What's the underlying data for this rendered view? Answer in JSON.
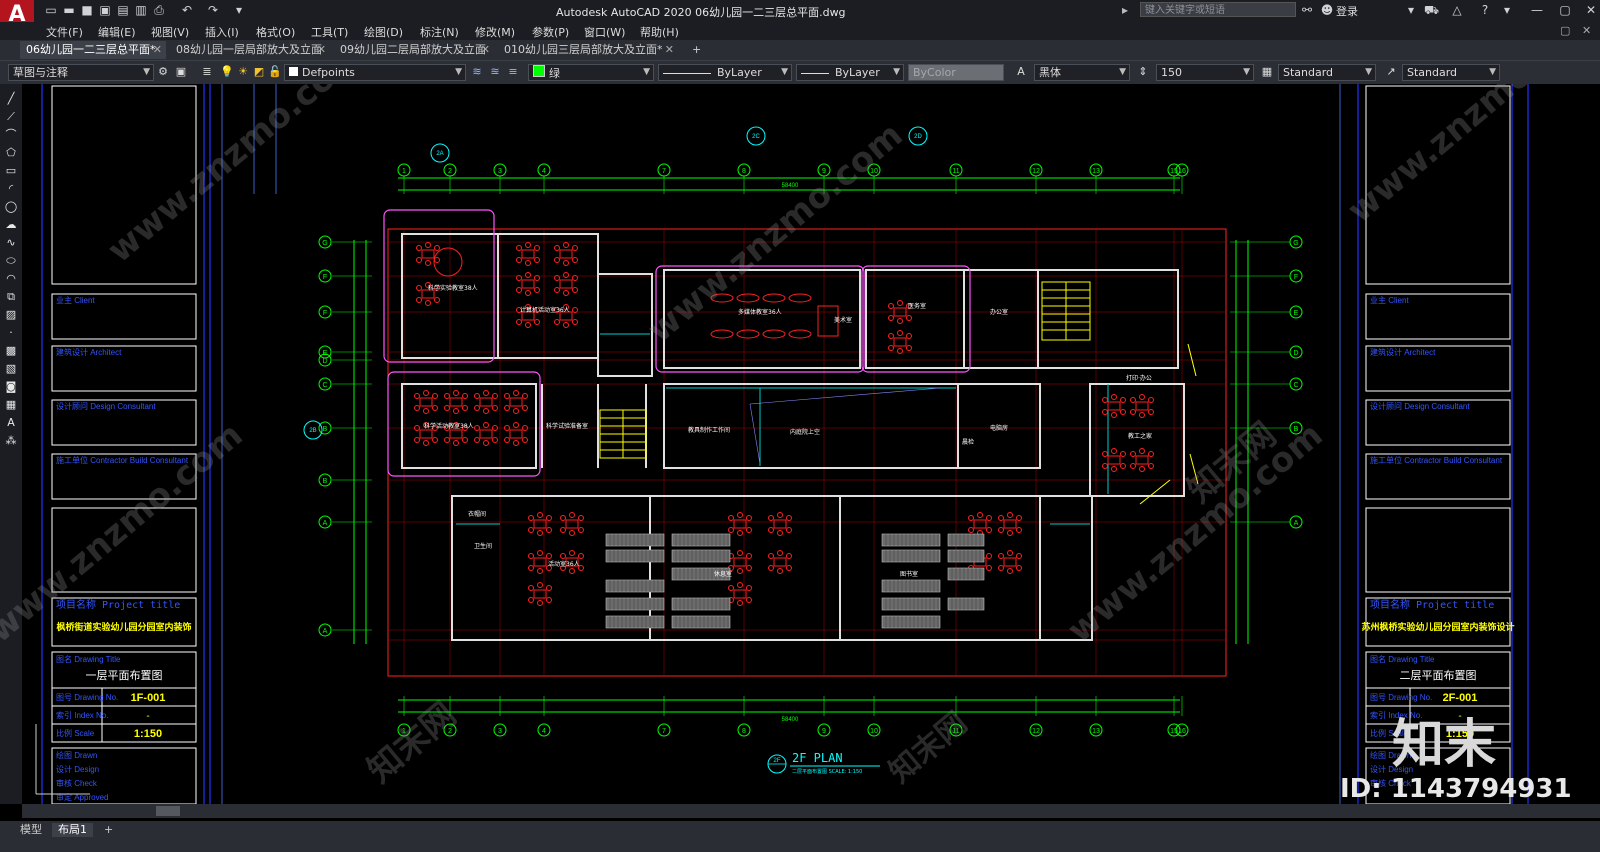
{
  "app": {
    "logo": "A",
    "title": "Autodesk AutoCAD 2020    06幼儿园一二三层总平面.dwg",
    "search_placeholder": "键入关键字或短语",
    "login": "登录"
  },
  "menu": [
    "文件(F)",
    "编辑(E)",
    "视图(V)",
    "插入(I)",
    "格式(O)",
    "工具(T)",
    "绘图(D)",
    "标注(N)",
    "修改(M)",
    "参数(P)",
    "窗口(W)",
    "帮助(H)"
  ],
  "tabs": [
    {
      "label": "06幼儿园一二三层总平面*",
      "active": true
    },
    {
      "label": "08幼儿园一层局部放大及立面",
      "active": false
    },
    {
      "label": "09幼儿园二层局部放大及立面",
      "active": false
    },
    {
      "label": "010幼儿园三层局部放大及立面*",
      "active": false
    }
  ],
  "toolbar": {
    "workspace": "草图与注释",
    "layer": "Defpoints",
    "color": "绿",
    "linetype": "ByLayer",
    "lineweight": "ByLayer",
    "plotstyle": "ByColor",
    "font": "黑体",
    "textheight": "150",
    "dimstyle": "Standard",
    "tablestyle": "Standard"
  },
  "left_titleblock": {
    "owner": "业主 Client",
    "architect": "建筑设计 Architect",
    "consultant": "设计顾问 Design Consultant",
    "contractor": "施工单位 Contractor Build Consultant",
    "project_title_label": "项目名称 Project title",
    "project_title": "枫桥街道实验幼儿园分园室内装饰",
    "drawing_title_label": "图名 Drawing Title",
    "drawing_title": "一层平面布置图",
    "drawing_no_label": "图号 Drawing No.",
    "drawing_no": "1F-001",
    "index_label": "索引 Index No.",
    "index": "-",
    "scale_label": "比例 Scale",
    "scale": "1:150",
    "drawn_label": "绘图 Drawn",
    "design_label": "设计 Design",
    "check_label": "审核 Check",
    "approved_label": "审定 Approved"
  },
  "right_titleblock": {
    "owner": "业主 Client",
    "architect": "建筑设计 Architect",
    "consultant": "设计顾问 Design Consultant",
    "contractor": "施工单位 Contractor Build Consultant",
    "project_title_label": "项目名称 Project title",
    "project_title": "苏州枫桥实验幼儿园分园室内装饰设计",
    "drawing_title_label": "图名 Drawing Title",
    "drawing_title": "二层平面布置图",
    "drawing_no_label": "图号 Drawing No.",
    "drawing_no": "2F-001",
    "index_label": "索引 Index No.",
    "index": "-",
    "scale_label": "比例 Scale",
    "scale": "1:150",
    "drawn_label": "绘图 Drawn",
    "design_label": "设计 Design",
    "check_label": "审核 Check"
  },
  "plan": {
    "title": "2F PLAN",
    "subtitle": "二层平面布置图    SCALE: 1:150",
    "title_tag": "2F",
    "axis_top": [
      "1",
      "2",
      "3",
      "4",
      "7",
      "8",
      "9",
      "10",
      "11",
      "12",
      "13",
      "15",
      "16"
    ],
    "axis_left": [
      "G",
      "F",
      "F",
      "E",
      "D",
      "C",
      "B",
      "B",
      "A",
      "A"
    ],
    "axis_right": [
      "G",
      "F",
      "E",
      "D",
      "C",
      "B",
      "A"
    ],
    "section_tags": [
      "2A",
      "2B",
      "2C",
      "2D"
    ],
    "rooms": [
      "科学实验教室38人",
      "计算机活动室36人",
      "科学活动教室38人",
      "科学试验准备室",
      "多媒体教室36人",
      "美术室",
      "医务室",
      "办公室",
      "内庭院上空",
      "教具制作工作间",
      "电脑房",
      "打印·办公",
      "教工之家",
      "活动室36人",
      "休息室",
      "卫生间",
      "衣帽间",
      "图书室",
      "晨检"
    ],
    "dim_total_top": "58400",
    "dim_total_bottom": "58400"
  },
  "watermarks": [
    "www.znzmo.com",
    "知末网"
  ],
  "brand": "知末",
  "id_text": "ID: 1143794931",
  "status": {
    "tabs": [
      "模型",
      "布局1"
    ]
  },
  "colors": {
    "accent_green": "#00ff00",
    "red": "#ff0000",
    "blue_frame": "#2233ff",
    "magenta": "#ff55ff",
    "cyan": "#00e5e5"
  }
}
